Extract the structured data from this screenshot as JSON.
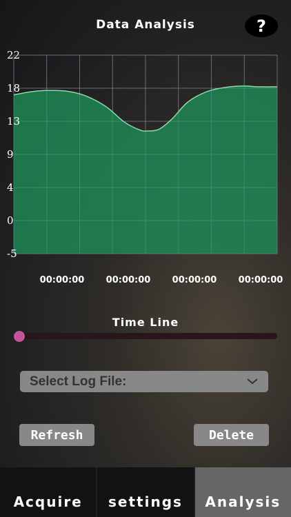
{
  "header": {
    "title": "Data Analysis",
    "help_label": "?"
  },
  "chart_data": {
    "type": "area",
    "y_ticks": [
      "22",
      "18",
      "13",
      "9",
      "4",
      "0",
      "-5"
    ],
    "x_labels": [
      "00:00:00",
      "00:00:00",
      "00:00:00",
      "00:00:00"
    ],
    "ylim": [
      -5,
      22
    ],
    "grid": true,
    "series": [
      {
        "color": "#1e8a55",
        "x": [
          0,
          0.06,
          0.12,
          0.2,
          0.27,
          0.35,
          0.42,
          0.48,
          0.51,
          0.55,
          0.6,
          0.66,
          0.73,
          0.8,
          0.87,
          0.93,
          1.0
        ],
        "values": [
          16.6,
          17.0,
          17.2,
          17.1,
          16.5,
          15.0,
          12.9,
          11.8,
          11.7,
          11.9,
          13.3,
          15.6,
          17.0,
          17.6,
          17.8,
          17.7,
          17.7
        ]
      }
    ]
  },
  "timeline": {
    "label": "Time Line",
    "position": 0.0
  },
  "log_select": {
    "placeholder": "Select Log File:",
    "icon": "chevron-down-icon"
  },
  "buttons": {
    "refresh": "Refresh",
    "delete": "Delete"
  },
  "tabs": [
    {
      "label": "Acquire",
      "active": false
    },
    {
      "label": "settings",
      "active": false
    },
    {
      "label": "Analysis",
      "active": true
    }
  ],
  "colors": {
    "area_fill": "#1e8a55",
    "area_line": "#7fe0a8",
    "slider_thumb": "#c2569a",
    "active_tab": "#666666"
  }
}
